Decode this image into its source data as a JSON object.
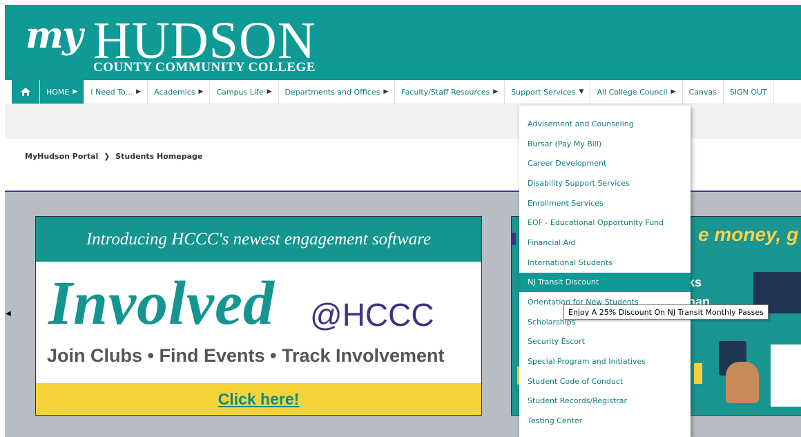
{
  "logo": {
    "my": "my",
    "hudson": "HUDSON",
    "subtitle": "COUNTY COMMUNITY COLLEGE"
  },
  "nav": {
    "home_icon": "home-icon",
    "items": [
      {
        "label": "HOME"
      },
      {
        "label": "I Need To..."
      },
      {
        "label": "Academics"
      },
      {
        "label": "Campus Life"
      },
      {
        "label": "Departments and Offices"
      },
      {
        "label": "Faculty/Staff Resources"
      },
      {
        "label": "Support Services"
      },
      {
        "label": "All College Council"
      },
      {
        "label": "Canvas"
      },
      {
        "label": "SIGN OUT"
      }
    ]
  },
  "breadcrumb": {
    "root": "MyHudson Portal",
    "current": "Students Homepage"
  },
  "dropdown": {
    "items": [
      "Advisement and Counseling",
      "Bursar (Pay My Bill)",
      "Career Development",
      "Disability Support Services",
      "Enrollment Services",
      "EOF - Educational Opportunity Fund",
      "Financial Aid",
      "International Students",
      "NJ Transit Discount",
      "Orientation for New Students",
      "Scholarships",
      "Security Escort",
      "Special Program and Initiatives",
      "Student Code of Conduct",
      "Student Records/Registrar",
      "Testing Center"
    ],
    "hovered": "NJ Transit Discount"
  },
  "tooltip": "Enjoy A 25% Discount On NJ Transit Monthly Passes",
  "banner": {
    "header": "Introducing HCCC's newest engagement software",
    "brand": "Involved",
    "brand_suffix": "@HCCC",
    "tagline": "Join Clubs • Find Events • Track Involvement",
    "cta": "Click here!"
  },
  "banner2": {
    "headline": "e money, g",
    "line1": "ks",
    "line2": "nan"
  },
  "colors": {
    "teal": "#0f9a96",
    "purple": "#4b2f8f",
    "yellow": "#f5d33b"
  }
}
